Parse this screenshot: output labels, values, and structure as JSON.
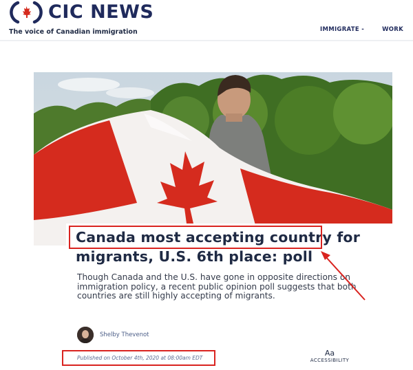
{
  "site": {
    "logo_text": "CIC NEWS",
    "tagline": "The voice of Canadian immigration"
  },
  "nav": {
    "items": [
      {
        "label": "IMMIGRATE -"
      },
      {
        "label": "WORK"
      }
    ]
  },
  "article": {
    "title": "Canada most accepting country for migrants, U.S. 6th place: poll",
    "summary": "Though Canada and the U.S. have gone in opposite directions on immigration policy, a recent public opinion poll suggests that both countries are still highly accepting of migrants.",
    "author": "Shelby Thevenot",
    "published": "Published on October 4th, 2020 at 08:00am EDT"
  },
  "accessibility": {
    "icon_text": "Aa",
    "label": "ACCESSIBILITY"
  },
  "colors": {
    "brand_navy": "#1f2a5c",
    "flag_red": "#d52b1e",
    "annotation_red": "#d9231f"
  },
  "icons": [
    "maple-leaf-logo-icon",
    "avatar-photo"
  ]
}
